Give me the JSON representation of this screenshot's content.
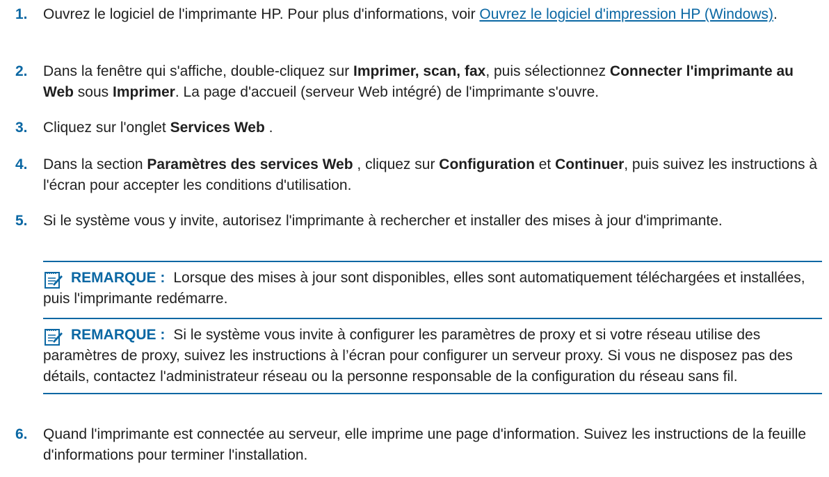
{
  "steps": [
    {
      "num": "1.",
      "a": "Ouvrez le logiciel de l'imprimante HP. Pour plus d'informations, voir ",
      "link": "Ouvrez le logiciel d'impression HP (Windows)",
      "b": "."
    },
    {
      "num": "2.",
      "a": "Dans la fenêtre qui s'affiche, double-cliquez sur ",
      "b1": "Imprimer, scan, fax",
      "a2": ", puis sélectionnez ",
      "b2": "Connecter l'imprimante au Web",
      "a3": " sous ",
      "b3": "Imprimer",
      "a4": ". La page d'accueil (serveur Web intégré) de l'imprimante s'ouvre."
    },
    {
      "num": "3.",
      "a": "Cliquez sur l'onglet ",
      "b1": "Services Web",
      "a2": " ."
    },
    {
      "num": "4.",
      "a": "Dans la section ",
      "b1": "Paramètres des services Web",
      "a2": " , cliquez sur ",
      "b2": "Configuration",
      "a3": " et ",
      "b3": "Continuer",
      "a4": ", puis suivez les instructions à l'écran pour accepter les conditions d'utilisation."
    },
    {
      "num": "5.",
      "a": "Si le système vous y invite, autorisez l'imprimante à rechercher et installer des mises à jour d'imprimante."
    },
    {
      "num": "6.",
      "a": "Quand l'imprimante est connectée au serveur, elle imprime une page d'information. Suivez les instructions de la feuille d'informations pour terminer l'installation."
    }
  ],
  "notes": [
    {
      "label": "REMARQUE :",
      "text": "Lorsque des mises à jour sont disponibles, elles sont automatiquement téléchargées et installées, puis l'imprimante redémarre."
    },
    {
      "label": "REMARQUE :",
      "text": "Si le système vous invite à configurer les paramètres de proxy et si votre réseau utilise des paramètres de proxy, suivez les instructions à l’écran pour configurer un serveur proxy. Si vous ne disposez pas des détails, contactez l'administrateur réseau ou la personne responsable de la configuration du réseau sans fil."
    }
  ],
  "colors": {
    "accent": "#0a67a3",
    "text": "#1f1f1f"
  },
  "icons": {
    "note": "note-pad-icon"
  }
}
